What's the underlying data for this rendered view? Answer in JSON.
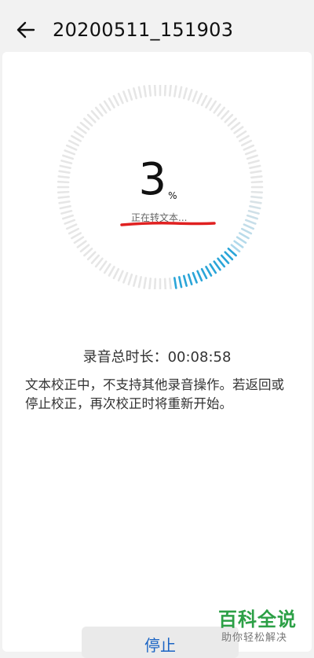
{
  "header": {
    "title": "20200511_151903"
  },
  "progress": {
    "value": "3",
    "unit": "%",
    "fraction": 0.03,
    "status": "正在转文本..."
  },
  "recording": {
    "duration_label": "录音总时长：00:08:58"
  },
  "notice": {
    "text": "文本校正中，不支持其他录音操作。若返回或停止校正，再次校正时将重新开始。"
  },
  "actions": {
    "stop_label": "停止"
  },
  "watermark": {
    "main": "百科全说",
    "sub": "助你轻松解决"
  },
  "colors": {
    "accent": "#1a64c4",
    "ring_active": "#2aa5d8",
    "ring_inactive": "#e6e6e6",
    "annotation": "#e02020",
    "watermark": "#2ca046"
  }
}
